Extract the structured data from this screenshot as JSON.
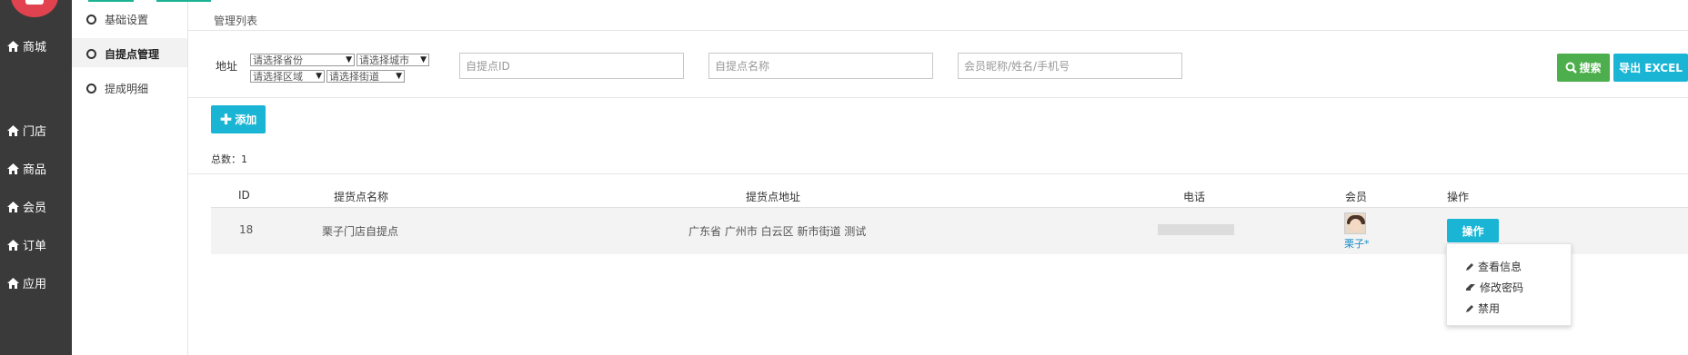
{
  "nav": {
    "items": [
      {
        "label": "商城",
        "icon": "home-icon"
      },
      {
        "label": "门店",
        "icon": "home-icon"
      },
      {
        "label": "商品",
        "icon": "home-icon"
      },
      {
        "label": "会员",
        "icon": "home-icon"
      },
      {
        "label": "订单",
        "icon": "home-icon"
      },
      {
        "label": "应用",
        "icon": "home-icon"
      }
    ]
  },
  "submenu": {
    "items": [
      {
        "label": "基础设置"
      },
      {
        "label": "自提点管理",
        "active": true
      },
      {
        "label": "提成明细"
      }
    ]
  },
  "main": {
    "title": "管理列表",
    "filters": {
      "address_label": "地址",
      "province": "请选择省份",
      "city": "请选择城市",
      "district": "请选择区域",
      "street": "请选择街道",
      "id_placeholder": "自提点ID",
      "name_placeholder": "自提点名称",
      "member_placeholder": "会员昵称/姓名/手机号"
    },
    "search_label": "搜索",
    "export_label": "导出 EXCEL",
    "add_label": "添加",
    "total_label": "总数：",
    "total_value": "1"
  },
  "table": {
    "headers": {
      "id": "ID",
      "name": "提货点名称",
      "address": "提货点地址",
      "phone": "电话",
      "member": "会员",
      "actions": "操作"
    },
    "rows": [
      {
        "id": "18",
        "name": "栗子门店自提点",
        "address": "广东省 广州市 白云区 新市街道 测试",
        "member_name": "栗子*",
        "action_label": "操作"
      }
    ]
  },
  "dropdown": {
    "items": [
      {
        "label": "查看信息",
        "icon": "pencil-icon"
      },
      {
        "label": "修改密码",
        "icon": "eraser-icon"
      },
      {
        "label": "禁用",
        "icon": "pencil-icon"
      }
    ]
  },
  "colors": {
    "sidebar_bg": "#3a3a3a",
    "accent_green": "#1ab394",
    "search_green": "#4cae4c",
    "info_cyan": "#1ab5d5",
    "logo_red": "#e0434f",
    "link_blue": "#1a8fc9"
  }
}
